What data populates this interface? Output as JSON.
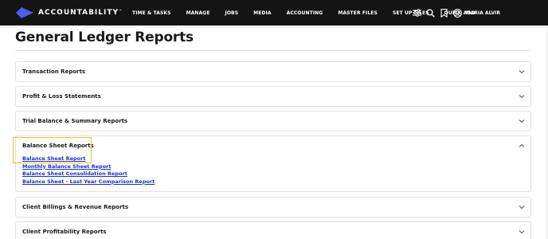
{
  "navbar": {
    "brand": "ACCOUNTABILITY",
    "brand_tm": "™",
    "menu": [
      "TIME & TASKS",
      "MANAGE",
      "JOBS",
      "MEDIA",
      "ACCOUNTING",
      "MASTER FILES",
      "SET UP FILES",
      "QUICK ADD"
    ],
    "user": "MARIA ALVIR"
  },
  "page": {
    "title": "General Ledger Reports"
  },
  "sections": [
    {
      "title": "Transaction Reports",
      "expanded": false
    },
    {
      "title": "Profit & Loss Statements",
      "expanded": false
    },
    {
      "title": "Trial Balance & Summary Reports",
      "expanded": false
    },
    {
      "title": "Balance Sheet Reports",
      "expanded": true,
      "links": [
        "Balance Sheet Report",
        "Monthly Balance Sheet Report",
        "Balance Sheet Consolidation Report",
        "Balance Sheet - Last Year Comparison Report"
      ]
    },
    {
      "title": "Client Billings & Revenue Reports",
      "expanded": false
    },
    {
      "title": "Client Profitability Reports",
      "expanded": false
    }
  ],
  "colors": {
    "navbar_bg": "#141414",
    "logo": "#4b5cf0",
    "link": "#1a33cc",
    "highlight": "#f5bd2e"
  }
}
